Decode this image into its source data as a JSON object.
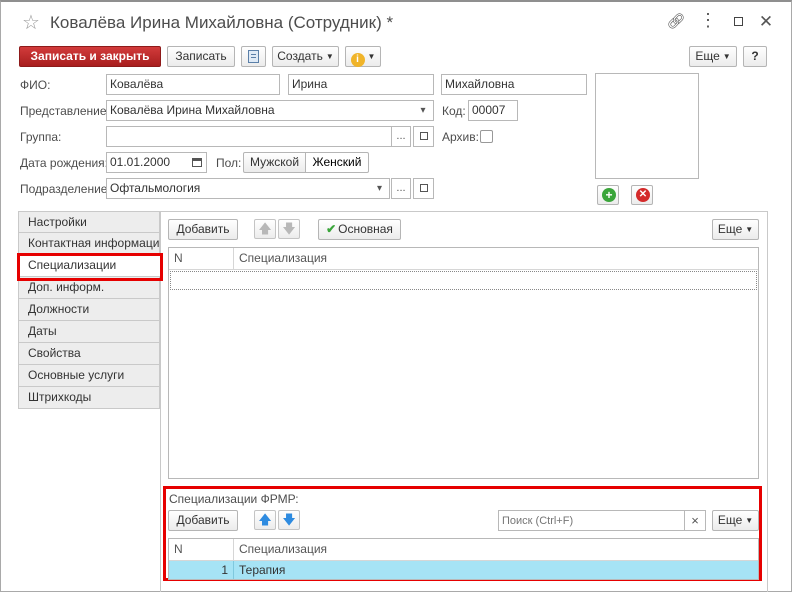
{
  "window": {
    "title": "Ковалёва Ирина Михайловна (Сотрудник) *",
    "star_icon": "star-icon",
    "controls": [
      "link-icon",
      "more-icon",
      "maximize-icon",
      "close-icon"
    ]
  },
  "toolbar": {
    "save_close": "Записать и закрыть",
    "save": "Записать",
    "create": "Создать",
    "more": "Еще",
    "help": "?"
  },
  "form": {
    "fio_label": "ФИО:",
    "last_name": "Ковалёва",
    "first_name": "Ирина",
    "middle_name": "Михайловна",
    "presentation_label": "Представление:",
    "presentation": "Ковалёва Ирина Михайловна",
    "code_label": "Код:",
    "code": "00007",
    "group_label": "Группа:",
    "group": "",
    "archive_label": "Архив:",
    "birth_label": "Дата рождения:",
    "birth_date": "01.01.2000",
    "sex_label": "Пол:",
    "sex_male": "Мужской",
    "sex_female": "Женский",
    "sex_selected": "Женский",
    "department_label": "Подразделение:",
    "department": "Офтальмология",
    "dots": "...",
    "dropdown_glyph": "▾"
  },
  "tabs": [
    {
      "label": "Настройки"
    },
    {
      "label": "Контактная информация"
    },
    {
      "label": "Специализации",
      "active": true
    },
    {
      "label": "Доп. информ."
    },
    {
      "label": "Должности"
    },
    {
      "label": "Даты"
    },
    {
      "label": "Свойства"
    },
    {
      "label": "Основные услуги"
    },
    {
      "label": "Штрихкоды"
    }
  ],
  "spec_panel": {
    "add": "Добавить",
    "main": "Основная",
    "more": "Еще",
    "col_n": "N",
    "col_spec": "Специализация",
    "rows": []
  },
  "frmr_panel": {
    "title": "Специализации ФРМР:",
    "add": "Добавить",
    "search_placeholder": "Поиск (Ctrl+F)",
    "clear": "×",
    "more": "Еще",
    "col_n": "N",
    "col_spec": "Специализация",
    "rows": [
      {
        "n": "1",
        "spec": "Терапия"
      }
    ]
  },
  "colors": {
    "primary": "#b52525",
    "highlight": "#e60000",
    "selected_row": "#a6e3f5",
    "add_green": "#3aa53a",
    "delete_red": "#d42a2a",
    "arrow_blue": "#2e8be0"
  }
}
